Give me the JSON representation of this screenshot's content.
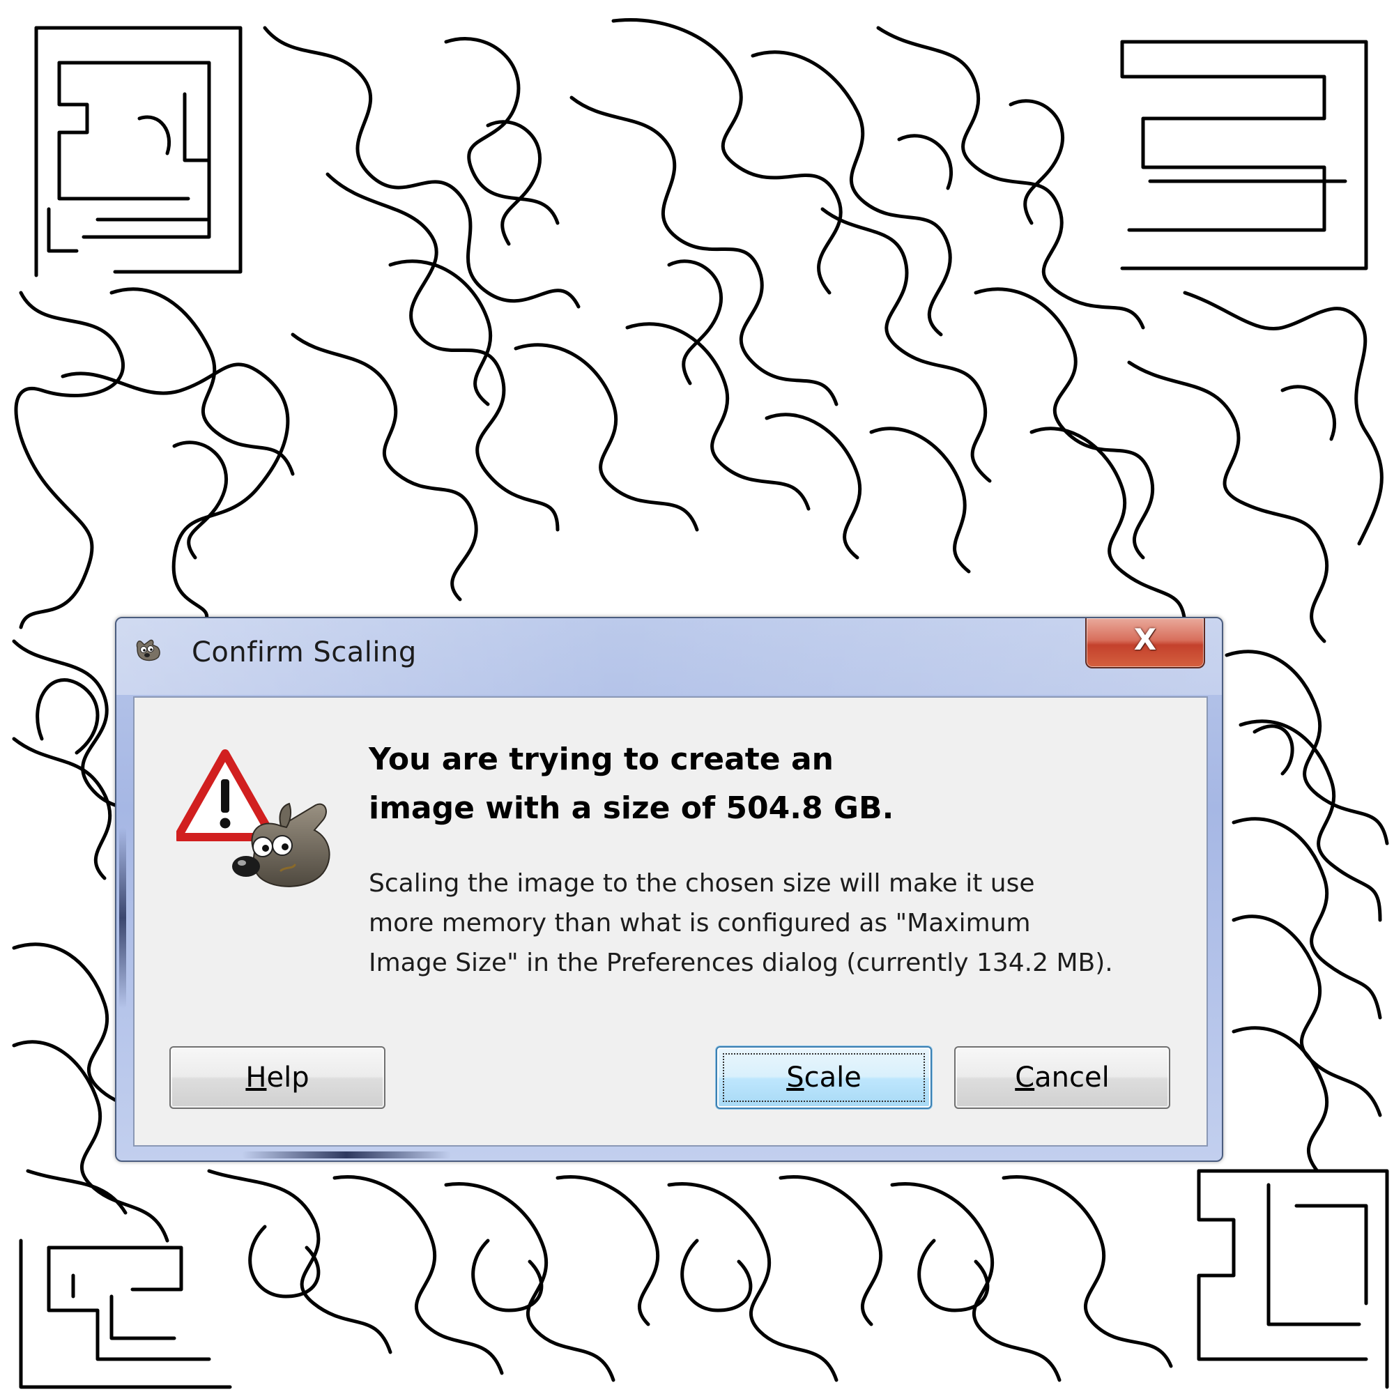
{
  "window": {
    "title": "Confirm Scaling",
    "title_icon": "gimp-wilber-icon",
    "close_label": "X"
  },
  "message": {
    "headline_line1": "You are trying to create an",
    "headline_line2": "image with a size of 504.8 GB.",
    "body_line1": "Scaling the image to the chosen size will make it use",
    "body_line2": "more memory than what is configured as \"Maximum",
    "body_line3": "Image Size\" in the Preferences dialog (currently 134.2 MB).",
    "icon": "warning-triangle-wilber-icon"
  },
  "buttons": {
    "help": {
      "mnemonic": "H",
      "rest": "elp"
    },
    "scale": {
      "mnemonic": "S",
      "rest": "cale"
    },
    "cancel": {
      "mnemonic": "C",
      "rest": "ancel"
    }
  },
  "colors": {
    "title_bar": "#a6b7e4",
    "close_button": "#c4412c",
    "client_background": "#f0f0f0",
    "default_button_border": "#3c7fb1",
    "warning_red": "#d11f1f",
    "background_maze_line": "#000000"
  }
}
